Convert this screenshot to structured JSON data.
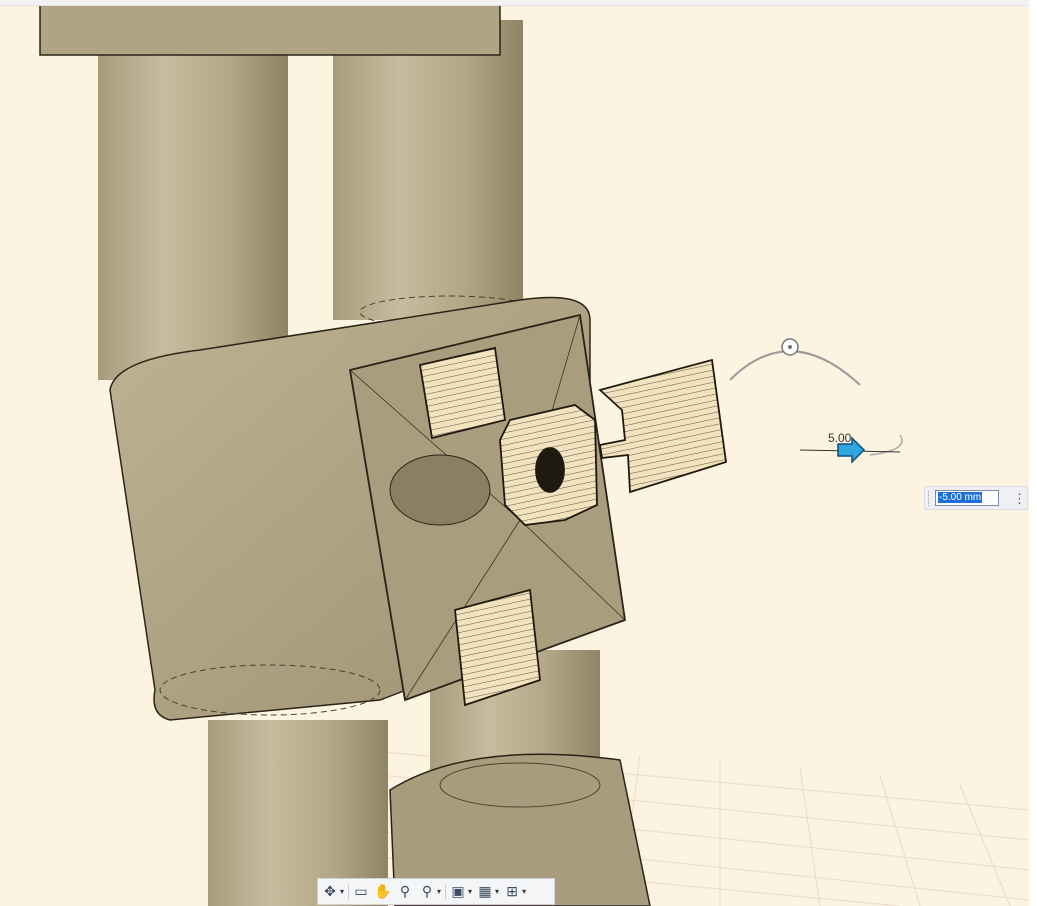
{
  "viewport": {
    "background_color": "#fdf3e1",
    "body_color": "#b4a888",
    "edge_color": "#2a2418"
  },
  "dimension": {
    "arrow_label": "5.00",
    "input_value": "-5.00 mm",
    "more_icon": "more-vertical-icon"
  },
  "navigation_bar": {
    "items": [
      {
        "name": "orbit",
        "icon": "orbit-icon",
        "glyph": "✥",
        "has_caret": true
      },
      {
        "name": "look-at",
        "icon": "look-at-icon",
        "glyph": "▭",
        "has_caret": false
      },
      {
        "name": "pan",
        "icon": "pan-hand-icon",
        "glyph": "✋",
        "has_caret": false
      },
      {
        "name": "zoom",
        "icon": "zoom-icon",
        "glyph": "⚲",
        "has_caret": false
      },
      {
        "name": "fit",
        "icon": "zoom-window-icon",
        "glyph": "⚲",
        "has_caret": true
      },
      {
        "name": "display-settings",
        "icon": "display-settings-icon",
        "glyph": "▣",
        "has_caret": true
      },
      {
        "name": "grid-and-snaps",
        "icon": "grid-icon",
        "glyph": "▦",
        "has_caret": true
      },
      {
        "name": "viewports",
        "icon": "viewports-icon",
        "glyph": "⊞",
        "has_caret": true
      }
    ]
  }
}
